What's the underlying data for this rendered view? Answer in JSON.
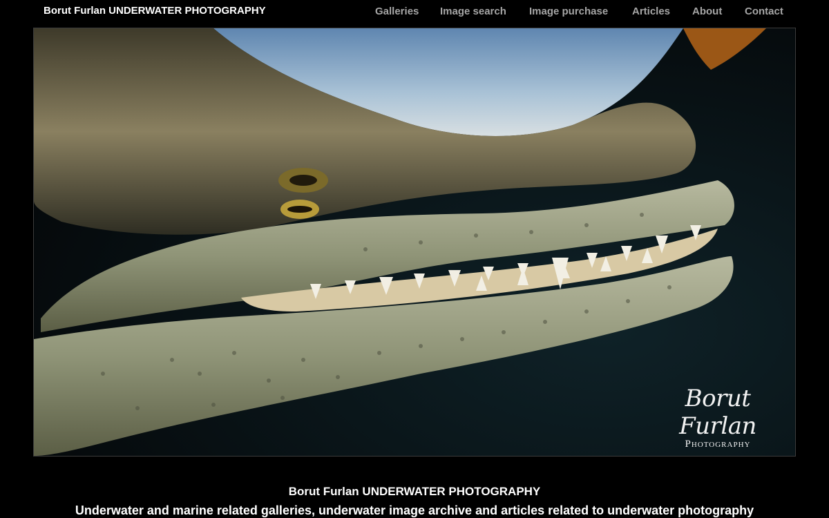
{
  "header": {
    "site_title": "Borut Furlan UNDERWATER PHOTOGRAPHY",
    "nav": [
      {
        "label": "Galleries"
      },
      {
        "label": "Image search"
      },
      {
        "label": "Image purchase"
      },
      {
        "label": "Articles"
      },
      {
        "label": "About"
      },
      {
        "label": "Contact"
      }
    ]
  },
  "hero": {
    "subject": "crocodile-underwater-photo",
    "watermark": {
      "name": "Borut Furlan",
      "sub": "Photography"
    }
  },
  "footer": {
    "title": "Borut Furlan UNDERWATER PHOTOGRAPHY",
    "description": "Underwater and marine related galleries, underwater image archive and articles related to underwater photography"
  },
  "colors": {
    "background": "#000000",
    "nav_text": "#a6a6a6",
    "title_text": "#ffffff"
  }
}
